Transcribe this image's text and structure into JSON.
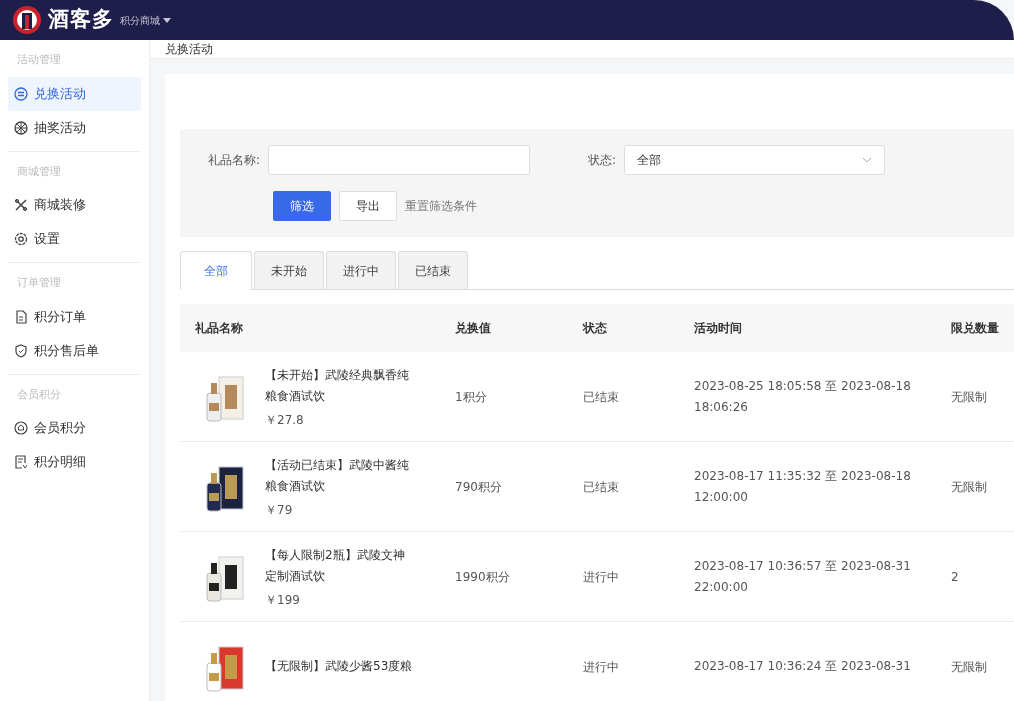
{
  "header": {
    "logo_text": "酒客多",
    "app_switcher": "积分商城"
  },
  "sidebar": {
    "groups": [
      {
        "title": "活动管理",
        "items": [
          {
            "label": "兑换活动",
            "selected": true
          },
          {
            "label": "抽奖活动",
            "selected": false
          }
        ]
      },
      {
        "title": "商城管理",
        "items": [
          {
            "label": "商城装修",
            "selected": false
          },
          {
            "label": "设置",
            "selected": false
          }
        ]
      },
      {
        "title": "订单管理",
        "items": [
          {
            "label": "积分订单",
            "selected": false
          },
          {
            "label": "积分售后单",
            "selected": false
          }
        ]
      },
      {
        "title": "会员积分",
        "items": [
          {
            "label": "会员积分",
            "selected": false
          },
          {
            "label": "积分明细",
            "selected": false
          }
        ]
      }
    ]
  },
  "breadcrumb": "兑换活动",
  "filter": {
    "name_label": "礼品名称:",
    "status_label": "状态:",
    "status_value": "全部",
    "buttons": [
      {
        "label": "筛选",
        "kind": "primary"
      },
      {
        "label": "导出",
        "kind": "outline"
      },
      {
        "label": "重置筛选条件",
        "kind": "link"
      }
    ]
  },
  "tabs": [
    {
      "label": "全部",
      "selected": true
    },
    {
      "label": "未开始",
      "selected": false
    },
    {
      "label": "进行中",
      "selected": false
    },
    {
      "label": "已结束",
      "selected": false
    }
  ],
  "table": {
    "columns": [
      "礼品名称",
      "兑换值",
      "状态",
      "活动时间",
      "限兑数量"
    ],
    "rows": [
      {
        "title": "【未开始】武陵经典飘香纯粮食酒试饮",
        "price": "￥27.8",
        "value": "1积分",
        "status": "已结束",
        "time": "2023-08-25 18:05:58 至 2023-08-18 18:06:26",
        "limit": "无限制"
      },
      {
        "title": "【活动已结束】武陵中酱纯粮食酒试饮",
        "price": "￥79",
        "value": "790积分",
        "status": "已结束",
        "time": "2023-08-17 11:35:32 至 2023-08-18 12:00:00",
        "limit": "无限制"
      },
      {
        "title": "【每人限制2瓶】武陵文神定制酒试饮",
        "price": "￥199",
        "value": "1990积分",
        "status": "进行中",
        "time": "2023-08-17 10:36:57 至 2023-08-31 22:00:00",
        "limit": "2"
      },
      {
        "title": "【无限制】武陵少酱53度粮",
        "status": "进行中",
        "time": "2023-08-17 10:36:24 至 2023-08-31",
        "limit": "无限制"
      }
    ]
  }
}
